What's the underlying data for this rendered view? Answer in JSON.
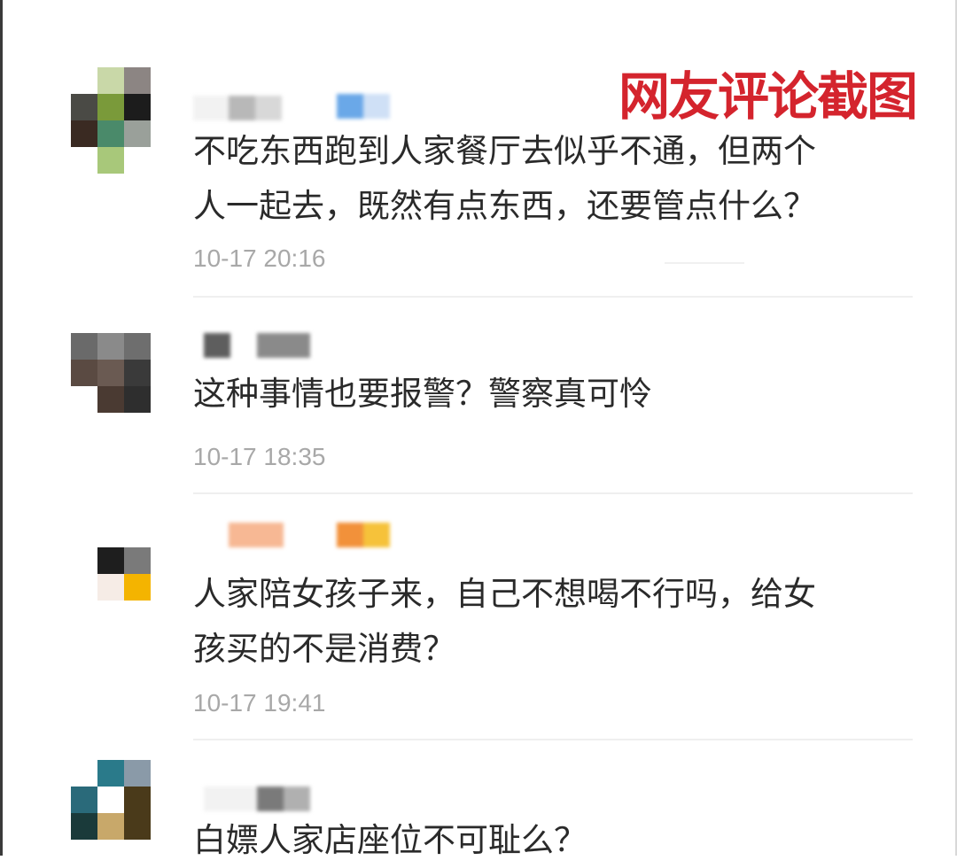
{
  "watermark": "网友评论截图",
  "comments": [
    {
      "lines": [
        "不吃东西跑到人家餐厅去似乎不通，但两个",
        "人一起去，既然有点东西，还要管点什么？"
      ],
      "time": "10-17 20:16",
      "avatar_colors": [
        "#c9d8a8",
        "#8c8583",
        "#4a4a45",
        "#7a9a3a",
        "#1c1c1c",
        "#3a2a22",
        "#4a8a6a",
        "#9aa09a",
        "#a8c87a"
      ]
    },
    {
      "lines": [
        "这种事情也要报警？警察真可怜"
      ],
      "time": "10-17 18:35",
      "avatar_colors": [
        "#6a6a6a",
        "#8a8a8a",
        "#6e6e6e",
        "#5a4a42",
        "#6a5a52",
        "#3a3a3a",
        "#4a3a32",
        "#2e2e2e"
      ]
    },
    {
      "lines": [
        "人家陪女孩子来，自己不想喝不行吗，给女",
        "孩买的不是消费？"
      ],
      "time": "10-17 19:41",
      "avatar_colors": [
        "#1e1e1e",
        "#7a7a7a",
        "#f6ece6",
        "#f4b400"
      ]
    },
    {
      "lines": [
        "白嫖人家店座位不可耻么？"
      ],
      "time": "",
      "avatar_colors": [
        "#2a7a8a",
        "#8a9aa8",
        "#2a6a7a",
        "#ffffff",
        "#4a3a1a",
        "#1a3a3a",
        "#c8a86a",
        "#4a3a1a"
      ]
    }
  ]
}
